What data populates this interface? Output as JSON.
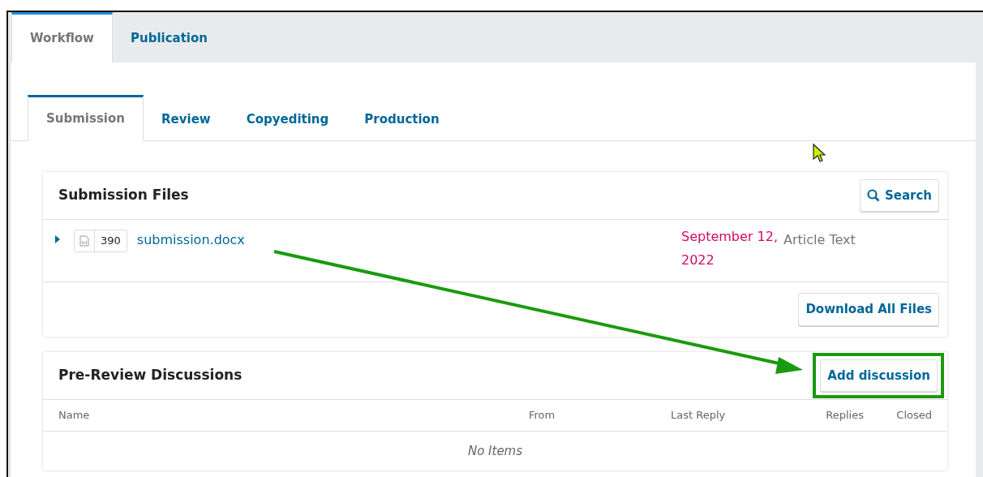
{
  "tabs": [
    {
      "label": "Workflow",
      "selected": true
    },
    {
      "label": "Publication",
      "selected": false
    }
  ],
  "stage_tabs": [
    {
      "label": "Submission",
      "selected": true
    },
    {
      "label": "Review",
      "selected": false
    },
    {
      "label": "Copyediting",
      "selected": false
    },
    {
      "label": "Production",
      "selected": false
    }
  ],
  "submission_files": {
    "title": "Submission Files",
    "search_button": "Search",
    "files": [
      {
        "expanded": false,
        "id": "390",
        "name": "submission.docx",
        "date": "September 12, 2022",
        "type": "Article Text"
      }
    ],
    "download_button": "Download All Files"
  },
  "discussions": {
    "title": "Pre-Review Discussions",
    "add_button": "Add discussion",
    "columns": [
      "Name",
      "From",
      "Last Reply",
      "Replies",
      "Closed"
    ],
    "empty_text": "No Items"
  }
}
